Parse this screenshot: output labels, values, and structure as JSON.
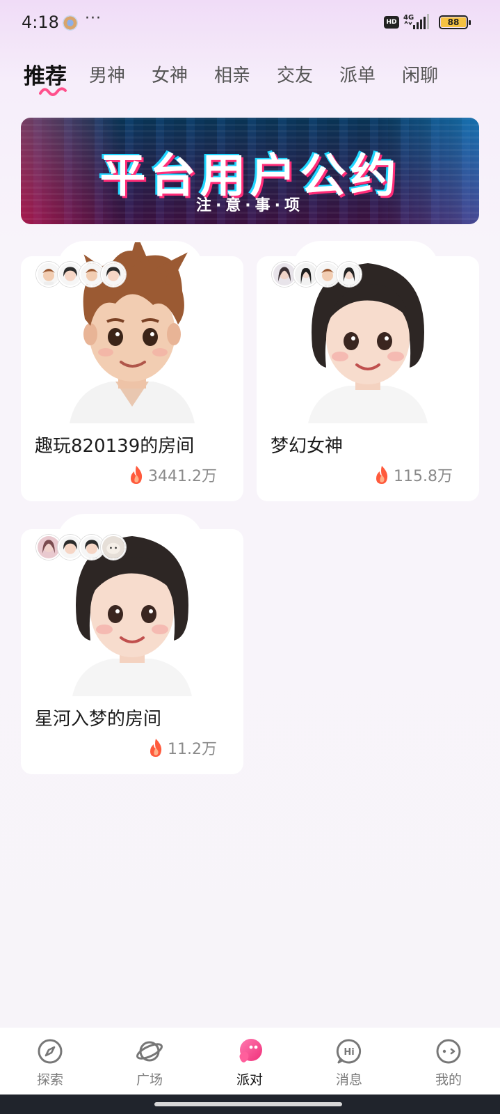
{
  "status_bar": {
    "time": "4:18",
    "more": "···",
    "network": "4G",
    "hd": "HD",
    "battery": "88"
  },
  "tabs": [
    {
      "label": "推荐",
      "active": true
    },
    {
      "label": "男神",
      "active": false
    },
    {
      "label": "女神",
      "active": false
    },
    {
      "label": "相亲",
      "active": false
    },
    {
      "label": "交友",
      "active": false
    },
    {
      "label": "派单",
      "active": false
    },
    {
      "label": "闲聊",
      "active": false
    }
  ],
  "banner": {
    "title": "平台用户公约",
    "subtitle": "注·意·事·项"
  },
  "rooms": [
    {
      "title": "趣玩820139的房间",
      "heat": "3441.2万",
      "host": "boy-avatar"
    },
    {
      "title": "梦幻女神",
      "heat": "115.8万",
      "host": "girl-avatar"
    },
    {
      "title": "星河入梦的房间",
      "heat": "11.2万",
      "host": "girl-avatar"
    }
  ],
  "bottom_nav": [
    {
      "label": "探索",
      "icon": "compass-icon",
      "active": false
    },
    {
      "label": "广场",
      "icon": "planet-icon",
      "active": false
    },
    {
      "label": "派对",
      "icon": "party-icon",
      "active": true
    },
    {
      "label": "消息",
      "icon": "hi-bubble-icon",
      "active": false
    },
    {
      "label": "我的",
      "icon": "face-icon",
      "active": false
    }
  ],
  "colors": {
    "accent": "#ff4f8b",
    "heat_icon": "#ff5a3c"
  }
}
